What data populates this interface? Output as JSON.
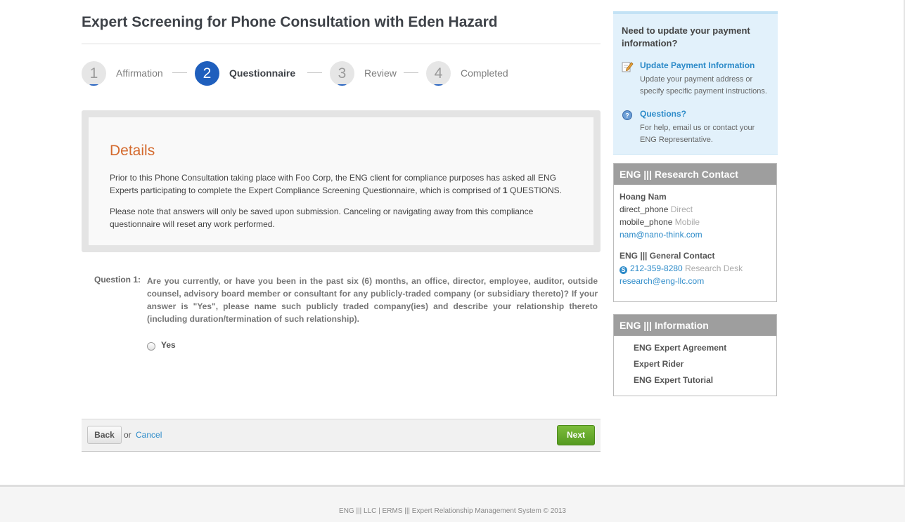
{
  "page": {
    "title": "Expert Screening for Phone Consultation with Eden Hazard"
  },
  "steps": [
    {
      "number": "1",
      "label": "Affirmation",
      "active": false
    },
    {
      "number": "2",
      "label": "Questionnaire",
      "active": true
    },
    {
      "number": "3",
      "label": "Review",
      "active": false
    },
    {
      "number": "4",
      "label": "Completed",
      "active": false
    }
  ],
  "details": {
    "heading": "Details",
    "p1_before": "Prior to this Phone Consultation taking place with Foo Corp, the ENG client for compliance purposes has asked all ENG Experts participating to complete the Expert Compliance Screening Questionnaire, which is comprised of ",
    "p1_count": "1",
    "p1_after": " QUESTIONS.",
    "p2": "Please note that answers will only be saved upon submission. Canceling or navigating away from this compliance questionnaire will reset any work performed."
  },
  "question": {
    "label": "Question 1:",
    "text": "Are you currently, or have you been in the past six (6) months, an office, director, employee, auditor, outside counsel, advisory board member or consultant for any publicly-traded company (or subsidiary thereto)? If your answer is \"Yes\", please name such publicly traded company(ies) and describe your relationship thereto (including duration/termination of such relationship).",
    "option_yes": "Yes"
  },
  "actions": {
    "back_label": "Back",
    "or_label": "or",
    "cancel_label": "Cancel",
    "next_label": "Next"
  },
  "payment": {
    "title": "Need to update your payment information?",
    "update_link": "Update Payment Information",
    "update_desc": "Update your payment address or specify specific payment instructions.",
    "questions_link": "Questions?",
    "questions_desc": "For help, email us or contact your ENG Representative."
  },
  "research_contact": {
    "heading": "ENG ||| Research Contact",
    "name": "Hoang Nam",
    "direct_phone": "direct_phone",
    "direct_label": "Direct",
    "mobile_phone": "mobile_phone",
    "mobile_label": "Mobile",
    "email": "nam@nano-think.com",
    "general_heading": "ENG ||| General Contact",
    "general_phone": "212-359-8280",
    "general_phone_label": "Research Desk",
    "general_email": "research@eng-llc.com"
  },
  "information": {
    "heading": "ENG ||| Information",
    "links": [
      "ENG Expert Agreement",
      "Expert Rider",
      "ENG Expert Tutorial"
    ]
  },
  "footer": {
    "text": "ENG ||| LLC | ERMS ||| Expert Relationship Management System © 2013"
  },
  "icons": {
    "edit": "pencil-edit-icon",
    "help": "help-question-icon",
    "phone": "skype-phone-icon"
  },
  "colors": {
    "active_step": "#1f5fbd",
    "details_heading": "#d46a2e",
    "link": "#2d8bc9",
    "next_button": "#5fa82a",
    "panel_header": "#9e9e9e",
    "payment_box": "#e2f1fb"
  }
}
